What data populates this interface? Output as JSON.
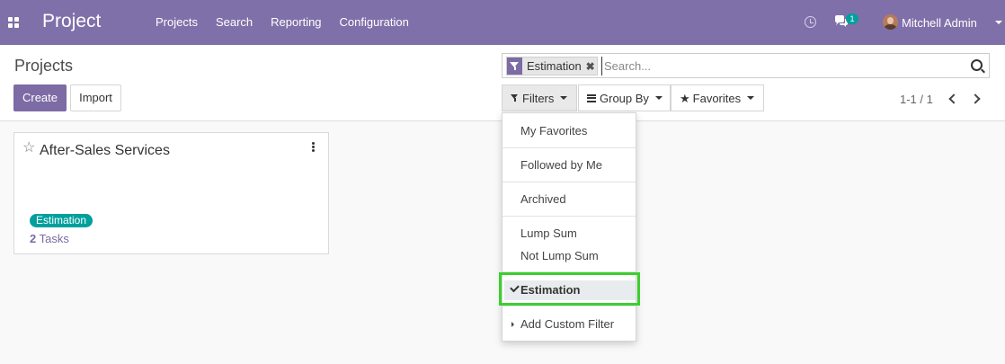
{
  "navbar": {
    "app_title": "Project",
    "menu": [
      "Projects",
      "Search",
      "Reporting",
      "Configuration"
    ],
    "chat_badge": "1",
    "user_name": "Mitchell Admin"
  },
  "control_panel": {
    "breadcrumb": "Projects",
    "create_label": "Create",
    "import_label": "Import",
    "search": {
      "facet_label": "Estimation",
      "facet_remove": "✖",
      "placeholder": "Search..."
    },
    "filters_label": "Filters",
    "groupby_label": "Group By",
    "favorites_label": "Favorites",
    "pager": "1-1 / 1"
  },
  "card": {
    "title": "After-Sales Services",
    "tag": "Estimation",
    "task_count": "2",
    "task_label": "Tasks"
  },
  "filters_menu": {
    "items": [
      "My Favorites",
      "Followed by Me",
      "Archived",
      "Lump Sum",
      "Not Lump Sum",
      "Estimation",
      "Add Custom Filter"
    ],
    "selected": "Estimation"
  },
  "colors": {
    "brand": "#8070a9",
    "tag": "#00a09d",
    "highlight": "#3ccf2e"
  }
}
